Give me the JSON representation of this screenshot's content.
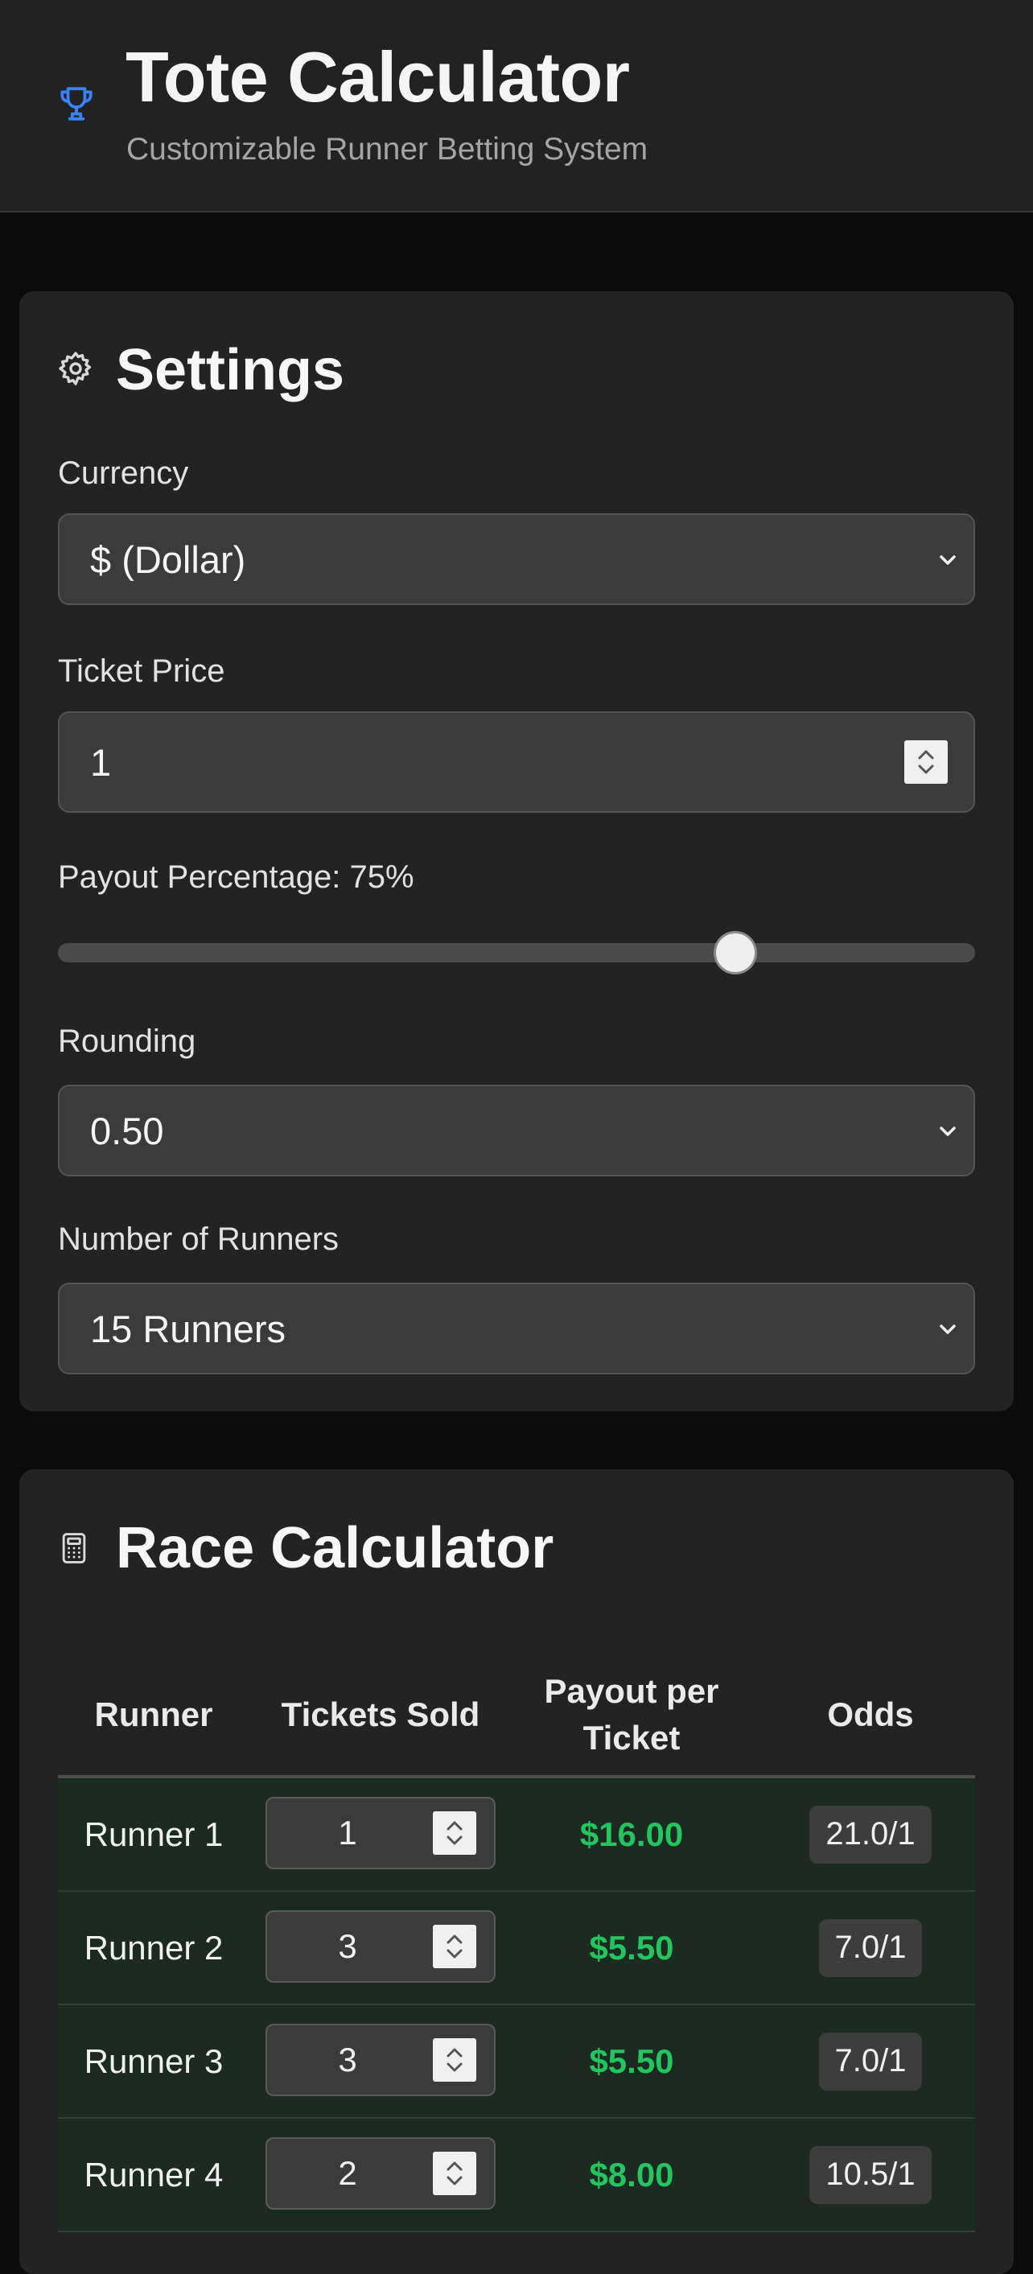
{
  "header": {
    "title": "Tote Calculator",
    "subtitle": "Customizable Runner Betting System",
    "icon": "trophy-icon",
    "accent": "#3b82f6"
  },
  "settings": {
    "title": "Settings",
    "icon": "gear-icon",
    "currency": {
      "label": "Currency",
      "value": "$ (Dollar)"
    },
    "ticket_price": {
      "label": "Ticket Price",
      "value": "1"
    },
    "payout": {
      "label": "Payout Percentage: 75%",
      "value": 75,
      "min": 0,
      "max": 100
    },
    "rounding": {
      "label": "Rounding",
      "value": "0.50"
    },
    "runners": {
      "label": "Number of Runners",
      "value": "15 Runners"
    }
  },
  "calculator": {
    "title": "Race Calculator",
    "icon": "calculator-icon",
    "columns": {
      "runner": "Runner",
      "tickets": "Tickets Sold",
      "payout_line1": "Payout per",
      "payout_line2": "Ticket",
      "odds": "Odds"
    },
    "rows": [
      {
        "runner": "Runner 1",
        "tickets": "1",
        "payout": "$16.00",
        "odds": "21.0/1"
      },
      {
        "runner": "Runner 2",
        "tickets": "3",
        "payout": "$5.50",
        "odds": "7.0/1"
      },
      {
        "runner": "Runner 3",
        "tickets": "3",
        "payout": "$5.50",
        "odds": "7.0/1"
      },
      {
        "runner": "Runner 4",
        "tickets": "2",
        "payout": "$8.00",
        "odds": "10.5/1"
      }
    ],
    "payout_color": "#22c55e",
    "row_bg": "#1c2a22"
  }
}
